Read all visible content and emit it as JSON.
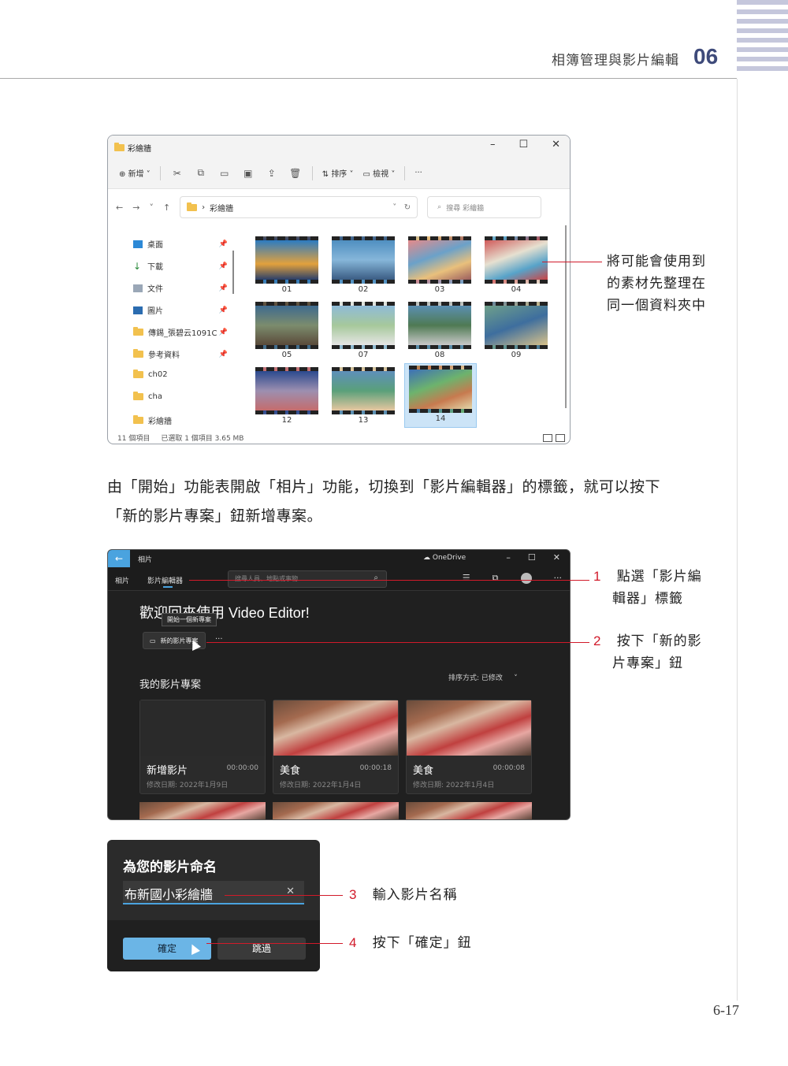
{
  "header": {
    "chapter_title": "相簿管理與影片編輯",
    "chapter_number": "06"
  },
  "page_number": "6-17",
  "explorer": {
    "title": "彩繪牆",
    "toolbar": {
      "new_label": "新增",
      "sort_label": "排序",
      "view_label": "檢視",
      "more": "···"
    },
    "address": "彩繪牆",
    "search_placeholder": "搜尋 彩繪牆",
    "nav": [
      {
        "label": "桌面",
        "icon": "desktop-icon"
      },
      {
        "label": "下載",
        "icon": "download-icon"
      },
      {
        "label": "文件",
        "icon": "document-icon"
      },
      {
        "label": "圖片",
        "icon": "pictures-icon"
      },
      {
        "label": "傳錫_張碧云1091C",
        "icon": "folder-icon"
      },
      {
        "label": "參考資料",
        "icon": "folder-icon"
      },
      {
        "label": "ch02",
        "icon": "folder-icon"
      },
      {
        "label": "cha",
        "icon": "folder-icon"
      },
      {
        "label": "彩繪牆",
        "icon": "folder-icon"
      }
    ],
    "files": [
      "01",
      "02",
      "03",
      "04",
      "05",
      "07",
      "08",
      "09",
      "12",
      "13",
      "14"
    ],
    "selected_file": "14",
    "status": {
      "count": "11 個項目",
      "selection": "已選取 1 個項目  3.65 MB"
    }
  },
  "callout_explorer": [
    "將可能會使用到",
    "的素材先整理在",
    "同一個資料夾中"
  ],
  "paragraph": [
    "由「開始」功能表開啟「相片」功能，切換到「影片編輯器」的標籤，就可以按下",
    "「新的影片專案」鈕新增專案。"
  ],
  "editor": {
    "app_title": "相片",
    "onedrive": "OneDrive",
    "tabs": [
      "相片",
      "影片編輯器"
    ],
    "search_placeholder": "搜尋人員、地點或事物",
    "welcome": "歡迎回來使用 Video Editor!",
    "tooltip": "開始一個新專案",
    "new_project_button": "新的影片專案",
    "section_title": "我的影片專案",
    "sort": "排序方式: 已修改",
    "cards": [
      {
        "name": "新增影片",
        "duration": "00:00:00",
        "date": "修改日期: 2022年1月9日"
      },
      {
        "name": "美食",
        "duration": "00:00:18",
        "date": "修改日期: 2022年1月4日"
      },
      {
        "name": "美食",
        "duration": "00:00:08",
        "date": "修改日期: 2022年1月4日"
      }
    ]
  },
  "callouts_editor": [
    {
      "num": "1",
      "lines": [
        "點選「影片編",
        "輯器」標籤"
      ]
    },
    {
      "num": "2",
      "lines": [
        "按下「新的影",
        "片專案」鈕"
      ]
    }
  ],
  "dialog": {
    "title": "為您的影片命名",
    "input_value": "布新國小彩繪牆",
    "ok_label": "確定",
    "skip_label": "跳過"
  },
  "callouts_dialog": [
    {
      "num": "3",
      "text": "輸入影片名稱"
    },
    {
      "num": "4",
      "text": "按下「確定」鈕"
    }
  ],
  "colors": {
    "accent_red": "#d11a2a",
    "accent_blue": "#4aa3df",
    "chapter_blue": "#3e4a7a"
  }
}
